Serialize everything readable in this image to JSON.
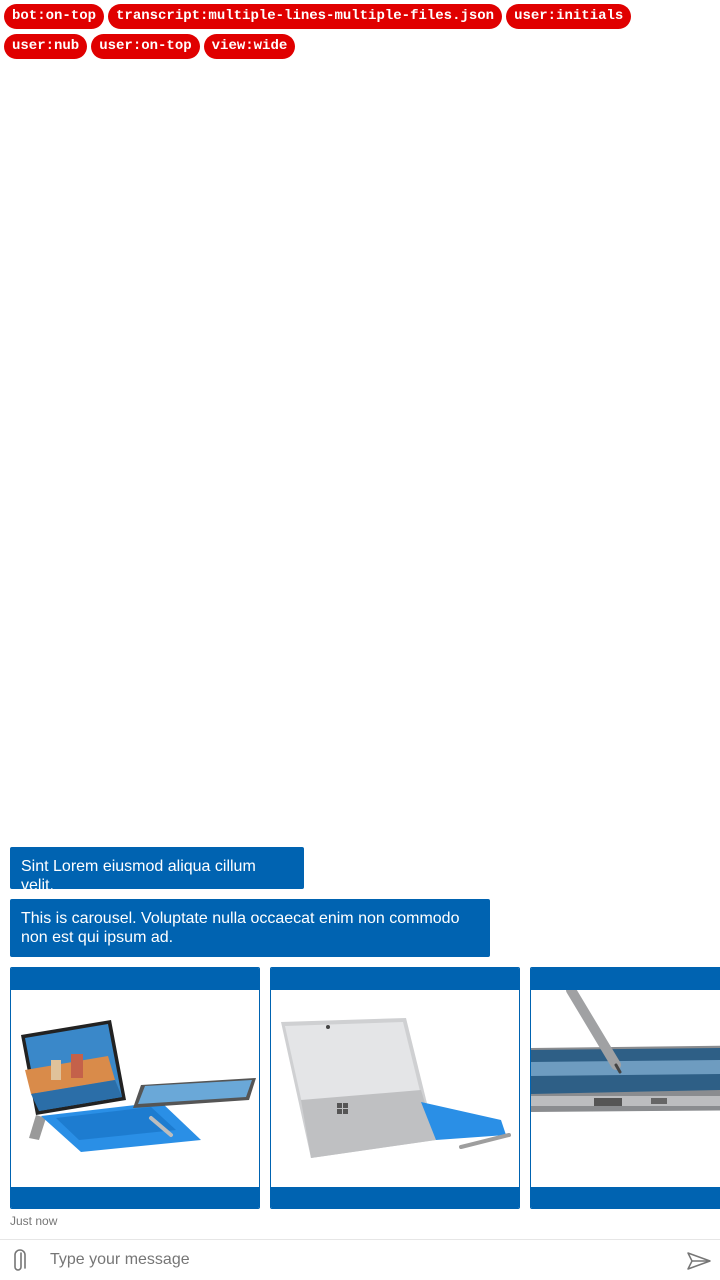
{
  "tags": {
    "row1": [
      "bot:on-top",
      "transcript:multiple-lines-multiple-files.json",
      "user:initials"
    ],
    "row2": [
      "user:nub",
      "user:on-top",
      "view:wide"
    ]
  },
  "messages": [
    {
      "text": "Sint Lorem eiusmod aliqua cillum velit."
    },
    {
      "text": "This is carousel. Voluptate nulla occaecat enim non commodo non est qui ipsum ad."
    }
  ],
  "carousel": {
    "items": [
      {
        "image": "surface-pro-front-with-keyboard-and-pen"
      },
      {
        "image": "surface-pro-back-kickstand"
      },
      {
        "image": "surface-pen-on-screen-closeup"
      }
    ]
  },
  "timestamp": "Just now",
  "composer": {
    "placeholder": "Type your message",
    "attach_icon": "paperclip-icon",
    "send_icon": "send-icon"
  },
  "colors": {
    "accent": "#0063b1",
    "tag": "#e00000"
  }
}
